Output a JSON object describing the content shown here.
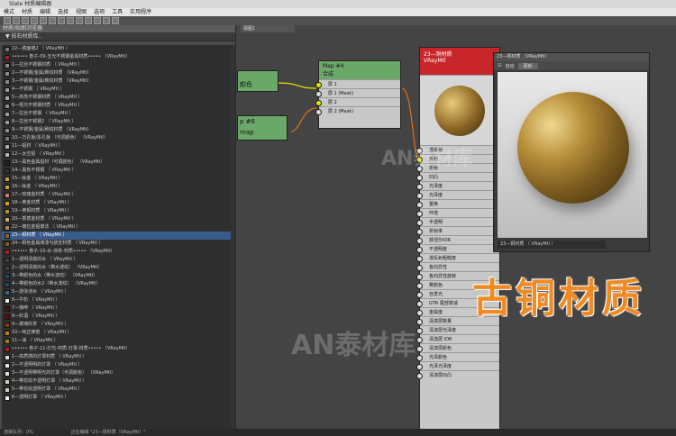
{
  "window": {
    "title": "Slate 材质编辑器",
    "menu": [
      "模式",
      "材质",
      "编辑",
      "选择",
      "视图",
      "选项",
      "工具",
      "实用程序"
    ]
  },
  "browser": {
    "title": "材质/贴图浏览器",
    "subtitle": "▼ 技石材质库..",
    "items": [
      {
        "label": "22—镜面铬2    （ VRayMtl ）",
        "color": "#777777"
      },
      {
        "label": "•••••• 巻子-09-五光不锈钢金属材质•••••   （VRayMtl）",
        "color": "#aa2222"
      },
      {
        "label": "1—拉丝不锈钢材质   （ VRayMtl ）",
        "color": "#888888"
      },
      {
        "label": "2—不锈钢/金属/刷纹材质   （VRayMtl）",
        "color": "#8a8a8a"
      },
      {
        "label": "3—不锈钢/金属/刷纹材质   （VRayMtl）",
        "color": "#8a8a8a"
      },
      {
        "label": "4—不锈钢    （ VRayMtl ）",
        "color": "#999999"
      },
      {
        "label": "5—高亮不锈钢材质   （ VRayMtl ）",
        "color": "#aaaaaa"
      },
      {
        "label": "6—哑光不锈钢材质   （ VRayMtl ）",
        "color": "#8c8c8c"
      },
      {
        "label": "7—拉丝不锈钢   （ VRayMtl ）",
        "color": "#9a9a9a"
      },
      {
        "label": "8—拉丝不锈钢2   （ VRayMtl ）",
        "color": "#9a9a9a"
      },
      {
        "label": "9—不锈钢/金属/刷纹材质   （VRayMtl）",
        "color": "#8a8a8a"
      },
      {
        "label": "10—万孔板/多孔板   （可调颜色）  （VRayMtl）",
        "color": "#7a7a7a"
      },
      {
        "label": "11—铝材    （ VRayMtl ）",
        "color": "#b0b0b0"
      },
      {
        "label": "12—太空铝   （ VRayMtl ）",
        "color": "#b8b8b8"
      },
      {
        "label": "13—黑色金属铝材（可调颜色）  （VRayMtl）",
        "color": "#222222"
      },
      {
        "label": "14—黑色不锈钢   （ VRayMtl ）",
        "color": "#333333"
      },
      {
        "label": "15—钛金   （ VRayMtl ）",
        "color": "#c8a040"
      },
      {
        "label": "16—钛金   （ VRayMtl ）",
        "color": "#c8a040"
      },
      {
        "label": "17—玫瑰金材质   （ VRayMtl ）",
        "color": "#c88070"
      },
      {
        "label": "18—黄金材质   （ VRayMtl ）",
        "color": "#d4a020"
      },
      {
        "label": "19—黄铜材质   （ VRayMtl ）",
        "color": "#b89030"
      },
      {
        "label": "20—香槟金材质   （ VRayMtl ）",
        "color": "#c8b070"
      },
      {
        "label": "22—镀拉金铝玻法   （ VRayMtl ）",
        "color": "#a09060"
      },
      {
        "label": "23—铜材质   （ VRayMtl ）",
        "color": "#8a6a2a",
        "selected": true
      },
      {
        "label": "24—铜色金属烤漆与航空材质   （ VRayMtl ）",
        "color": "#7a5a2a"
      },
      {
        "label": "•••••• 卷子-10-水-液体-材质•••••   （VRayMtl）",
        "color": "#aa2222"
      },
      {
        "label": "1—透明清澈的水   （ VRayMtl ）",
        "color": "#444444"
      },
      {
        "label": "2—透明清澈的水（带水波纹）   （VRayMtl）",
        "color": "#444444"
      },
      {
        "label": "3—带颜色的水（带水波纹）   （VRayMtl）",
        "color": "#2a4a5a"
      },
      {
        "label": "4—带颜色的水2（带水波纹）   （VRayMtl）",
        "color": "#2a4a5a"
      },
      {
        "label": "5—游泳池水   （ VRayMtl ）",
        "color": "#3a6a8a"
      },
      {
        "label": "6—牛奶   （ VRayMtl ）",
        "color": "#eeeeee"
      },
      {
        "label": "7—咖啡   （ VRayMtl ）",
        "color": "#3a2010"
      },
      {
        "label": "8—红酒   （ VRayMtl ）",
        "color": "#6a0a10"
      },
      {
        "label": "9—玻璃红茶   （ VRayMtl ）",
        "color": "#8a3a10"
      },
      {
        "label": "10—纯正蜂蜜   （ VRayMtl ）",
        "color": "#c08010"
      },
      {
        "label": "11—油   （ VRayMtl ）",
        "color": "#a08020"
      },
      {
        "label": "•••••• 卷子-11-灯光-材质-灯罩-材质•••••   （VRayMtl）",
        "color": "#aa2222"
      },
      {
        "label": "1—高质感的灯罩材质   （ VRayMtl ）",
        "color": "#dddddd"
      },
      {
        "label": "2—不透明明的灯罩   （ VRayMtl ）",
        "color": "#e6e6e6"
      },
      {
        "label": "3—不透明带明光的灯罩（可调颜色）  （VRayMtl）",
        "color": "#e0e0e0"
      },
      {
        "label": "4—带花纹不透明灯罩   （ VRayMtl ）",
        "color": "#d8d0c0"
      },
      {
        "label": "5—带花纹透明灯罩   （ VRayMtl ）",
        "color": "#d8d0c0"
      },
      {
        "label": "6—透明灯罩   （ VRayMtl ）",
        "color": "#f0f0f0"
      }
    ]
  },
  "canvas": {
    "view_tab": "视图1",
    "left_nodes": [
      {
        "label": "颜色"
      },
      {
        "label": "p #6"
      },
      {
        "label": "map"
      }
    ],
    "composite_node": {
      "header_line1": "Map #4",
      "header_line2": "合成",
      "slots": [
        "层 1",
        "层 1 (Mask)",
        "层 2",
        "层 2 (Mask)"
      ]
    },
    "vray_node": {
      "header_line1": "23—铜材质",
      "header_line2": "VRayMtl",
      "slots": [
        "漫反射",
        "反射",
        "折射",
        "凹凸",
        "光泽度",
        "光泽度",
        "置换",
        "环境",
        "半透明",
        "折射率",
        "菲涅尔IOR",
        "不透明度",
        "漫反射粗糙度",
        "各向异性",
        "各向异性旋转",
        "雾颜色",
        "自发光",
        "GTR 尾部衰减",
        "金属度",
        "清漆层数量",
        "清漆层光泽度",
        "清漆层 IOR",
        "清漆层颜色",
        "光泽颜色",
        "光泽光泽度",
        "清漆层凹凸"
      ]
    },
    "preview": {
      "title": "23—铜材质 （VRayMtl）",
      "auto_label": "自动",
      "update_label": "更新",
      "footer": "23—铜材质   （ VRayMtl ）"
    },
    "overlay_text": "古铜材质",
    "watermark": "AN泰材库"
  },
  "status": {
    "left": "渲染队列：0%",
    "right": "正在编辑 \"23—铜材质（VRayMtl）\""
  }
}
